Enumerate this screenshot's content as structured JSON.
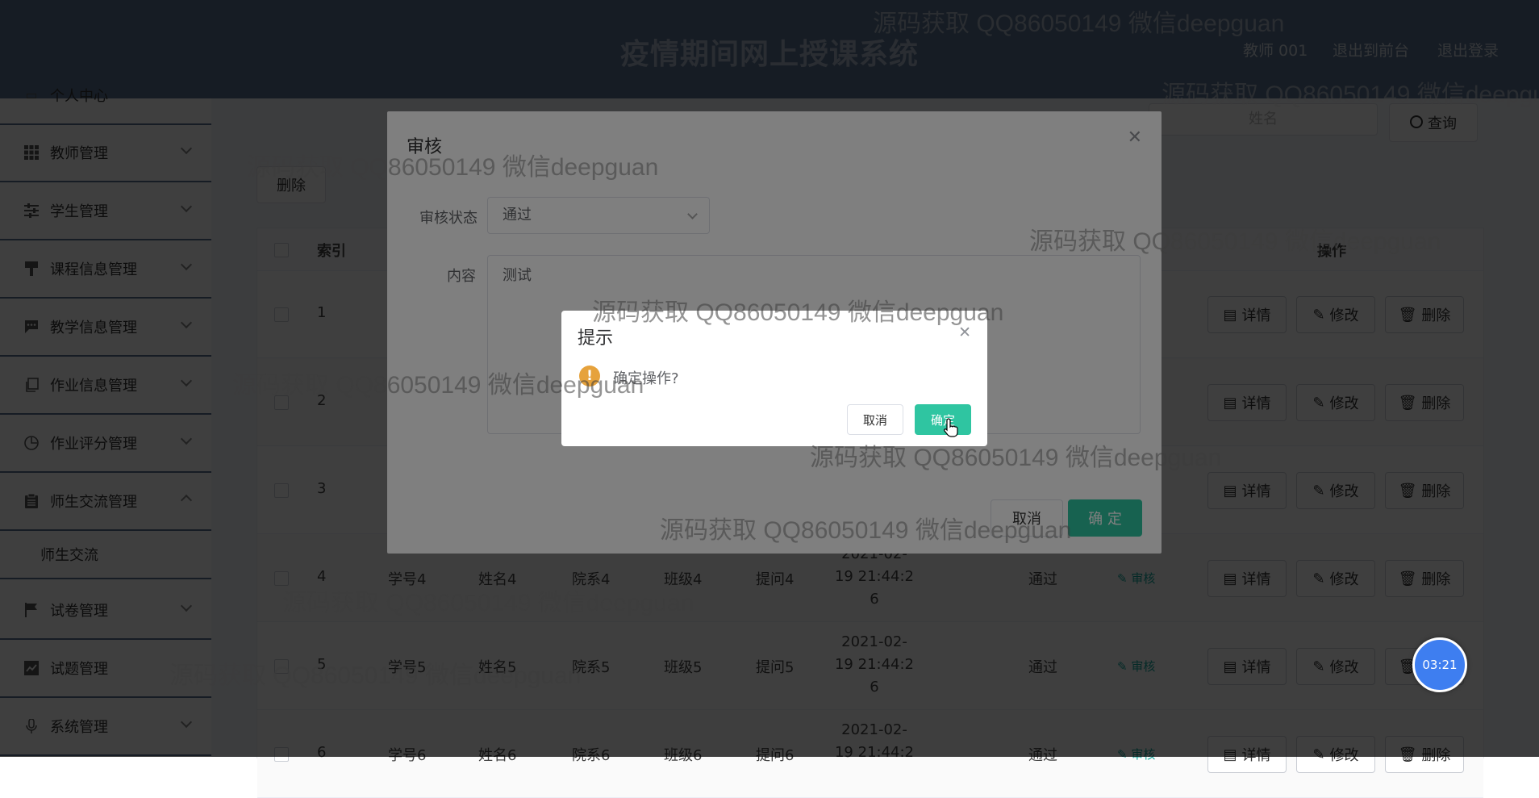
{
  "header": {
    "title": "疫情期间网上授课系统",
    "user": "教师 001",
    "to_front": "退出到前台",
    "logout": "退出登录"
  },
  "sidebar": {
    "top_partial": "个人中心",
    "items": [
      {
        "label": "教师管理",
        "icon": "grid-icon"
      },
      {
        "label": "学生管理",
        "icon": "sliders-icon"
      },
      {
        "label": "课程信息管理",
        "icon": "brush-icon"
      },
      {
        "label": "教学信息管理",
        "icon": "chat-icon"
      },
      {
        "label": "作业信息管理",
        "icon": "copy-icon"
      },
      {
        "label": "作业评分管理",
        "icon": "compass-icon"
      },
      {
        "label": "师生交流管理",
        "icon": "clipboard-icon"
      }
    ],
    "sub_item": "师生交流",
    "items2": [
      {
        "label": "试卷管理",
        "icon": "flag-icon"
      },
      {
        "label": "试题管理",
        "icon": "chart-icon"
      },
      {
        "label": "系统管理",
        "icon": "mic-icon"
      }
    ]
  },
  "toolbar": {
    "name_placeholder": "姓名",
    "search_label": "查询",
    "delete_label": "删除"
  },
  "table": {
    "headers": {
      "index": "索引",
      "actions": "操作"
    },
    "rows": [
      {
        "index": "1"
      },
      {
        "index": "2"
      },
      {
        "index": "3"
      },
      {
        "index": "4",
        "student_no": "学号4",
        "name": "姓名4",
        "college": "院系4",
        "class": "班级4",
        "question": "提问4",
        "date": "2021-02-",
        "time": "19 21:44:2",
        "sec": "6",
        "status": "通过"
      },
      {
        "index": "5",
        "student_no": "学号5",
        "name": "姓名5",
        "college": "院系5",
        "class": "班级5",
        "question": "提问5",
        "date": "2021-02-",
        "time": "19 21:44:2",
        "sec": "6",
        "status": "通过"
      },
      {
        "index": "6",
        "student_no": "学号6",
        "name": "姓名6",
        "college": "院系6",
        "class": "班级6",
        "question": "提问6",
        "date": "2021-02-",
        "time": "19 21:44:2",
        "sec": "",
        "status": "通过"
      }
    ],
    "action_detail": "详情",
    "action_edit": "修改",
    "action_delete": "删除",
    "action_audit": "审核"
  },
  "audit_dialog": {
    "title": "审核",
    "status_label": "审核状态",
    "status_value": "通过",
    "content_label": "内容",
    "content_value": "测试",
    "cancel": "取消",
    "confirm": "确 定"
  },
  "confirm_box": {
    "title": "提示",
    "message": "确定操作?",
    "cancel": "取消",
    "confirm": "确定"
  },
  "watermark": "源码获取 QQ86050149 微信deepguan",
  "timer": "03:21",
  "colors": {
    "header": "#5b7393",
    "accent": "#2fc5a1",
    "warning": "#e6a23c",
    "link": "#13a89e"
  }
}
